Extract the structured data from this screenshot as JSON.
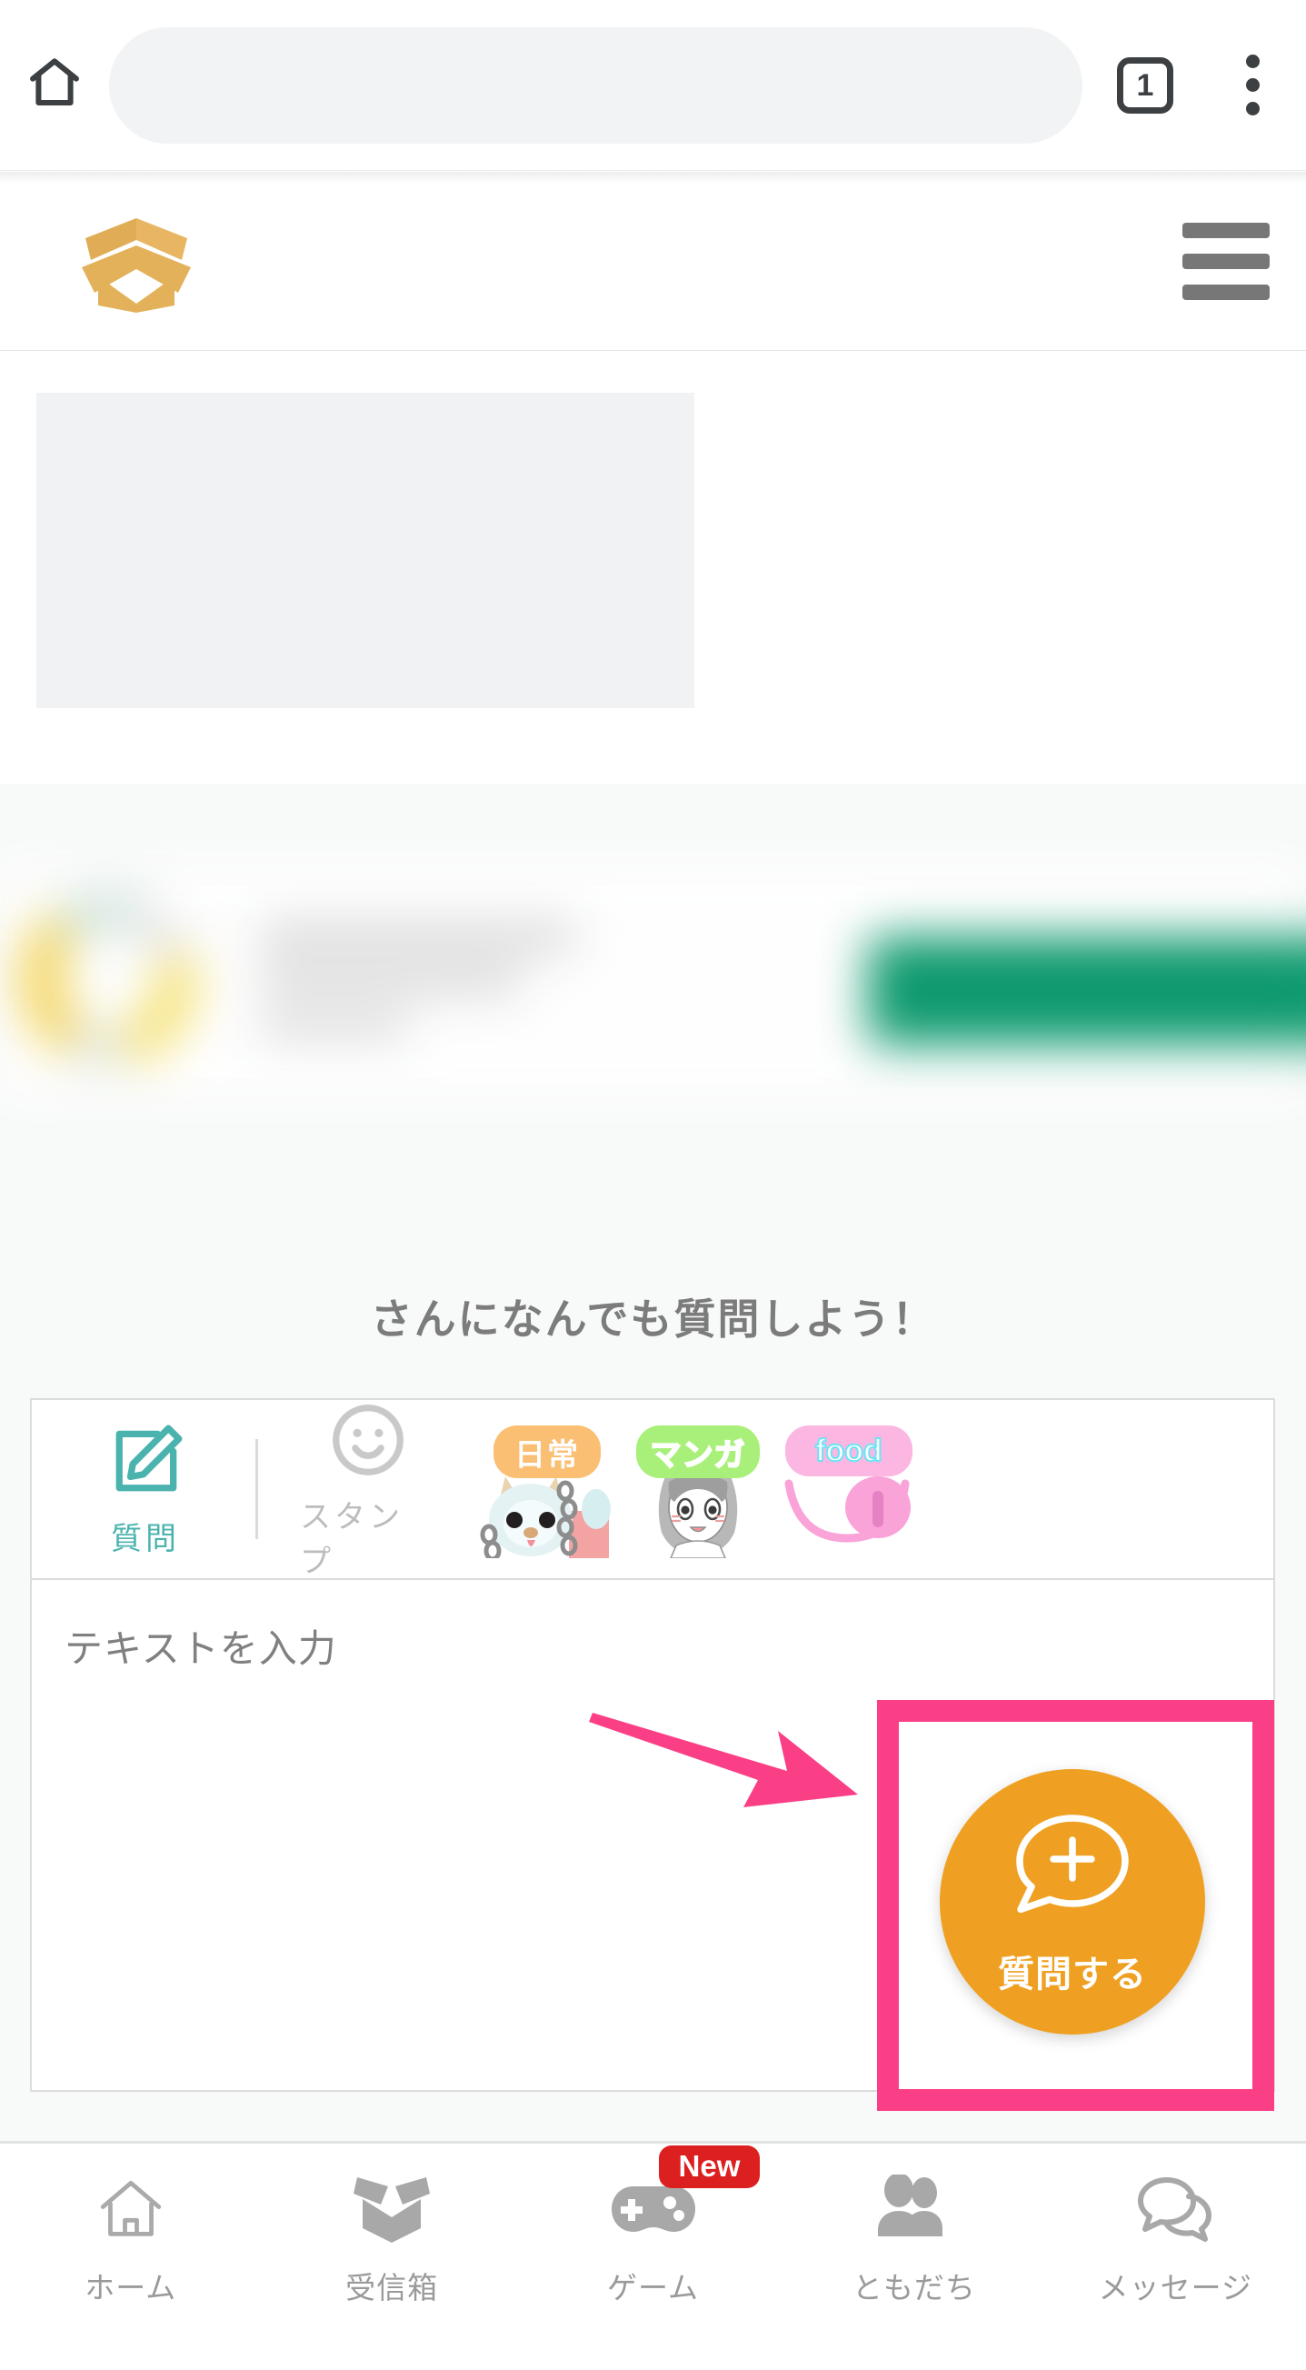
{
  "browser": {
    "home_icon": "home-icon",
    "url_value": "",
    "url_placeholder": "",
    "tab_count": "1",
    "menu_icon": "overflow-menu-icon"
  },
  "site_header": {
    "logo_icon": "open-box-logo",
    "menu_icon": "hamburger-menu-icon"
  },
  "ad_slot": {
    "label": ""
  },
  "promo_banner": {
    "avatar_icon": "profile-avatar",
    "cta_label": ""
  },
  "lead": {
    "heading": "さんになんでも質問しよう！"
  },
  "compose": {
    "tabs": [
      {
        "label": "質問",
        "icon": "compose-pencil-icon",
        "active": true,
        "color": "#4bb3ae"
      },
      {
        "label": "スタンプ",
        "icon": "smiley-face-icon",
        "active": false,
        "color": "#bdbdbd"
      }
    ],
    "stickers": [
      {
        "caption": "日常",
        "icon": "sticker-dog",
        "cap_bg": "#fbbf73"
      },
      {
        "caption": "マンガ",
        "icon": "sticker-manga-girl",
        "cap_bg": "#a9f07a"
      },
      {
        "caption": "food",
        "icon": "sticker-food-smile",
        "cap_bg": "#fbb7e2"
      }
    ],
    "input_placeholder": "テキストを入力",
    "input_value": ""
  },
  "ask_button": {
    "label": "質問する",
    "icon": "speech-bubble-plus-icon",
    "color": "#efa022"
  },
  "annotations": {
    "arrow_color": "#fb3f86",
    "box_color": "#fb3f86"
  },
  "bottom_nav": {
    "items": [
      {
        "label": "ホーム",
        "icon": "house-icon",
        "badge": ""
      },
      {
        "label": "受信箱",
        "icon": "open-box-icon",
        "badge": ""
      },
      {
        "label": "ゲーム",
        "icon": "gamepad-icon",
        "badge": "New"
      },
      {
        "label": "ともだち",
        "icon": "people-icon",
        "badge": ""
      },
      {
        "label": "メッセージ",
        "icon": "chat-bubbles-icon",
        "badge": ""
      }
    ]
  }
}
